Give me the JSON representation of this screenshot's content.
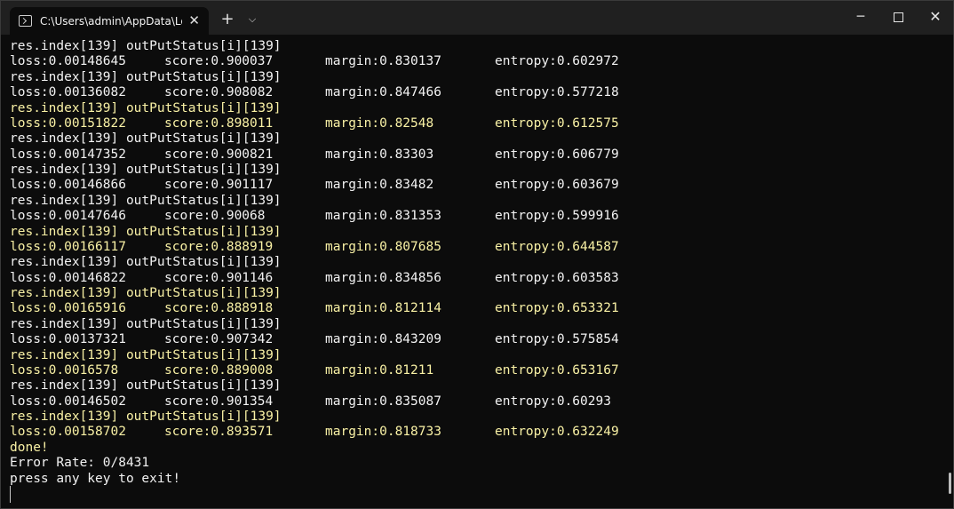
{
  "window": {
    "tab_title": "C:\\Users\\admin\\AppData\\Loca",
    "tab_close": "✕",
    "new_tab": "+",
    "dropdown": "⌵",
    "minimize": "─",
    "close": "✕"
  },
  "terminal": {
    "lines": [
      {
        "kind": "header",
        "text": "res.index[139] outPutStatus[i][139]",
        "color": "white"
      },
      {
        "kind": "row",
        "cols": [
          "loss:0.00148645",
          "score:0.900037",
          "margin:0.830137",
          "entropy:0.602972"
        ],
        "color": "white"
      },
      {
        "kind": "header",
        "text": "res.index[139] outPutStatus[i][139]",
        "color": "white"
      },
      {
        "kind": "row",
        "cols": [
          "loss:0.00136082",
          "score:0.908082",
          "margin:0.847466",
          "entropy:0.577218"
        ],
        "color": "white"
      },
      {
        "kind": "header",
        "text": "res.index[139] outPutStatus[i][139]",
        "color": "yellow"
      },
      {
        "kind": "row",
        "cols": [
          "loss:0.00151822",
          "score:0.898011",
          "margin:0.82548",
          "entropy:0.612575"
        ],
        "color": "yellow"
      },
      {
        "kind": "header",
        "text": "res.index[139] outPutStatus[i][139]",
        "color": "white"
      },
      {
        "kind": "row",
        "cols": [
          "loss:0.00147352",
          "score:0.900821",
          "margin:0.83303",
          "entropy:0.606779"
        ],
        "color": "white"
      },
      {
        "kind": "header",
        "text": "res.index[139] outPutStatus[i][139]",
        "color": "white"
      },
      {
        "kind": "row",
        "cols": [
          "loss:0.00146866",
          "score:0.901117",
          "margin:0.83482",
          "entropy:0.603679"
        ],
        "color": "white"
      },
      {
        "kind": "header",
        "text": "res.index[139] outPutStatus[i][139]",
        "color": "white"
      },
      {
        "kind": "row",
        "cols": [
          "loss:0.00147646",
          "score:0.90068",
          "margin:0.831353",
          "entropy:0.599916"
        ],
        "color": "white"
      },
      {
        "kind": "header",
        "text": "res.index[139] outPutStatus[i][139]",
        "color": "yellow"
      },
      {
        "kind": "row",
        "cols": [
          "loss:0.00166117",
          "score:0.888919",
          "margin:0.807685",
          "entropy:0.644587"
        ],
        "color": "yellow"
      },
      {
        "kind": "header",
        "text": "res.index[139] outPutStatus[i][139]",
        "color": "white"
      },
      {
        "kind": "row",
        "cols": [
          "loss:0.00146822",
          "score:0.901146",
          "margin:0.834856",
          "entropy:0.603583"
        ],
        "color": "white"
      },
      {
        "kind": "header",
        "text": "res.index[139] outPutStatus[i][139]",
        "color": "yellow"
      },
      {
        "kind": "row",
        "cols": [
          "loss:0.00165916",
          "score:0.888918",
          "margin:0.812114",
          "entropy:0.653321"
        ],
        "color": "yellow"
      },
      {
        "kind": "header",
        "text": "res.index[139] outPutStatus[i][139]",
        "color": "white"
      },
      {
        "kind": "row",
        "cols": [
          "loss:0.00137321",
          "score:0.907342",
          "margin:0.843209",
          "entropy:0.575854"
        ],
        "color": "white"
      },
      {
        "kind": "header",
        "text": "res.index[139] outPutStatus[i][139]",
        "color": "yellow"
      },
      {
        "kind": "row",
        "cols": [
          "loss:0.0016578",
          "score:0.889008",
          "margin:0.81211",
          "entropy:0.653167"
        ],
        "color": "yellow"
      },
      {
        "kind": "header",
        "text": "res.index[139] outPutStatus[i][139]",
        "color": "white"
      },
      {
        "kind": "row",
        "cols": [
          "loss:0.00146502",
          "score:0.901354",
          "margin:0.835087",
          "entropy:0.60293"
        ],
        "color": "white"
      },
      {
        "kind": "header",
        "text": "res.index[139] outPutStatus[i][139]",
        "color": "yellow"
      },
      {
        "kind": "row",
        "cols": [
          "loss:0.00158702",
          "score:0.893571",
          "margin:0.818733",
          "entropy:0.632249"
        ],
        "color": "yellow"
      },
      {
        "kind": "header",
        "text": "done!",
        "color": "yellow"
      },
      {
        "kind": "header",
        "text": "Error Rate: 0/8431",
        "color": "white"
      },
      {
        "kind": "header",
        "text": "press any key to exit!",
        "color": "white"
      }
    ]
  },
  "colors": {
    "background": "#0c0c0c",
    "titlebar": "#202020",
    "text_white": "#f2f2f2",
    "text_yellow": "#f9f1a5"
  }
}
